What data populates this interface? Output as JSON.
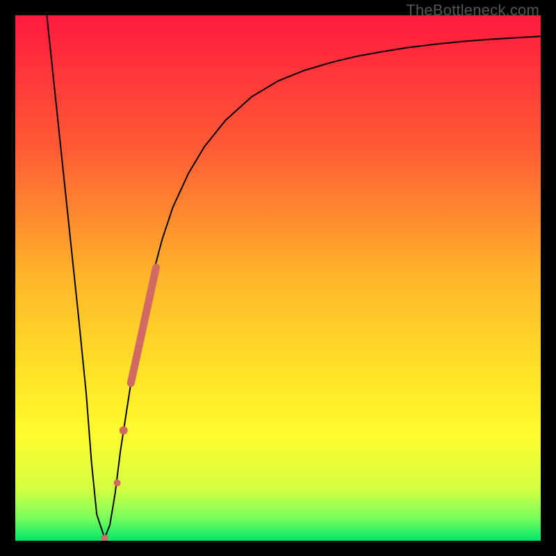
{
  "watermark": "TheBottleneck.com",
  "chart_data": {
    "type": "line",
    "title": "",
    "xlabel": "",
    "ylabel": "",
    "xlim": [
      0,
      100
    ],
    "ylim": [
      0,
      100
    ],
    "background_gradient": {
      "stops": [
        {
          "offset": 0.0,
          "color": "#ff1a3e"
        },
        {
          "offset": 0.25,
          "color": "#ff5a34"
        },
        {
          "offset": 0.5,
          "color": "#ffb62a"
        },
        {
          "offset": 0.7,
          "color": "#ffe727"
        },
        {
          "offset": 0.8,
          "color": "#fffc2e"
        },
        {
          "offset": 0.9,
          "color": "#d4ff40"
        },
        {
          "offset": 0.955,
          "color": "#7dff5a"
        },
        {
          "offset": 1.0,
          "color": "#00e76a"
        }
      ]
    },
    "series": [
      {
        "name": "bottleneck-curve",
        "color": "#000000",
        "stroke_width": 2,
        "x": [
          6.0,
          8.0,
          10.0,
          12.0,
          13.5,
          14.5,
          15.5,
          17.0,
          18.0,
          19.0,
          20.0,
          22.0,
          24.0,
          26.0,
          28.0,
          30.0,
          33.0,
          36.0,
          40.0,
          45.0,
          50.0,
          55.0,
          60.0,
          65.0,
          70.0,
          75.0,
          80.0,
          85.0,
          90.0,
          95.0,
          100.0
        ],
        "y": [
          100.0,
          81.0,
          62.0,
          43.0,
          28.0,
          15.0,
          5.0,
          0.5,
          3.0,
          9.0,
          17.0,
          30.0,
          41.0,
          50.0,
          57.5,
          63.5,
          70.0,
          75.0,
          80.0,
          84.5,
          87.5,
          89.5,
          91.0,
          92.2,
          93.1,
          93.9,
          94.5,
          95.0,
          95.4,
          95.7,
          96.0
        ]
      },
      {
        "name": "highlight-segment",
        "color": "#d16a62",
        "stroke_width": 11,
        "linecap": "round",
        "x": [
          22.0,
          26.8
        ],
        "y": [
          30.0,
          52.0
        ]
      },
      {
        "name": "highlight-dot-lower",
        "color": "#d16a62",
        "marker": "circle",
        "radius": 6,
        "x": [
          20.6
        ],
        "y": [
          21.0
        ]
      },
      {
        "name": "highlight-dot-upper",
        "color": "#d16a62",
        "marker": "circle",
        "radius": 5,
        "x": [
          19.4
        ],
        "y": [
          11.0
        ]
      },
      {
        "name": "highlight-dot-bottom",
        "color": "#d16a62",
        "marker": "circle",
        "radius": 5,
        "x": [
          17.0
        ],
        "y": [
          0.5
        ]
      }
    ]
  }
}
